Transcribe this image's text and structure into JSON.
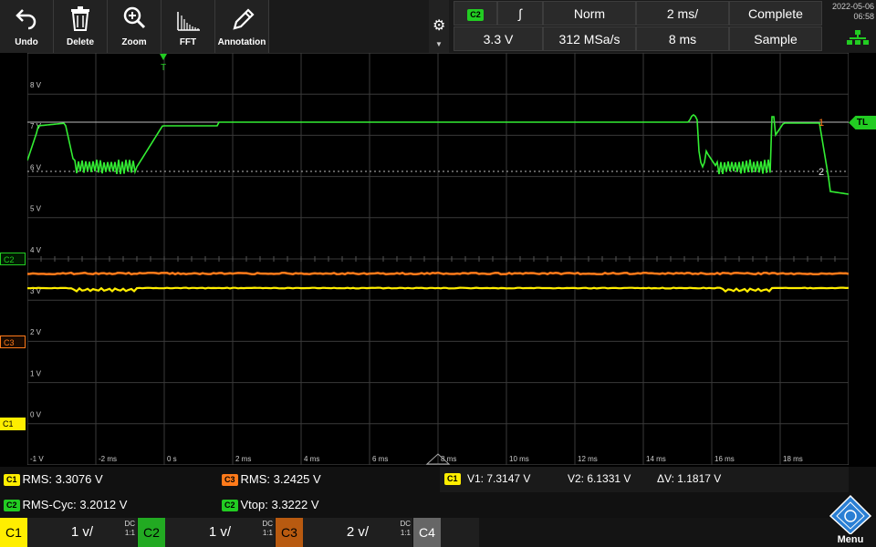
{
  "toolbar": {
    "undo": "Undo",
    "delete": "Delete",
    "zoom": "Zoom",
    "fft": "FFT",
    "annotation": "Annotation"
  },
  "trigger": {
    "source": "C2",
    "slope": "∫",
    "mode": "Norm",
    "level": "3.3 V",
    "timebase": "2 ms/",
    "sample_rate": "312 MSa/s",
    "position": "8 ms",
    "acq_state": "Complete",
    "acq_mode": "Sample"
  },
  "clock": {
    "date": "2022-05-06",
    "time": "06:58"
  },
  "grid": {
    "y_labels": [
      "8 V",
      "7 V",
      "6 V",
      "5 V",
      "4 V",
      "3 V",
      "2 V",
      "1 V",
      "0 V"
    ],
    "x_labels": [
      "-1 V",
      "-2 ms",
      "0 s",
      "2 ms",
      "4 ms",
      "6 ms",
      "8 ms",
      "10 ms",
      "12 ms",
      "14 ms",
      "16 ms",
      "18 ms"
    ],
    "trigger_mark": "T",
    "ch2_marker": "C2",
    "ch3_marker": "C3",
    "ch1_marker": "C1",
    "tl_label": "TL",
    "cursor1_label": "1",
    "cursor2_label": "2"
  },
  "measurements": {
    "m1_badge": "C1",
    "m1": "RMS: 3.3076 V",
    "m2_badge": "C2",
    "m2": "RMS-Cyc: 3.2012 V",
    "m3_badge": "C3",
    "m3": "RMS: 3.2425 V",
    "m4_badge": "C2",
    "m4": "Vtop: 3.3222 V"
  },
  "cursors": {
    "badge": "C1",
    "v1": "V1: 7.3147 V",
    "v2": "V2: 6.1331 V",
    "dv": "ΔV: 1.1817 V"
  },
  "channels": [
    {
      "id": "C1",
      "scale": "1 v/",
      "coupling": "DC",
      "ratio": "1:1",
      "color": "#ffee00"
    },
    {
      "id": "C2",
      "scale": "1 v/",
      "coupling": "DC",
      "ratio": "1:1",
      "color": "#22cc22"
    },
    {
      "id": "C3",
      "scale": "2 v/",
      "coupling": "DC",
      "ratio": "1:1",
      "color": "#ff7a1a"
    },
    {
      "id": "C4"
    }
  ],
  "menu": {
    "label": "Menu"
  },
  "colors": {
    "ch1": "#ffee00",
    "ch2": "#33ee33",
    "ch3": "#ff7a1a",
    "grid": "#3a3a3a"
  }
}
